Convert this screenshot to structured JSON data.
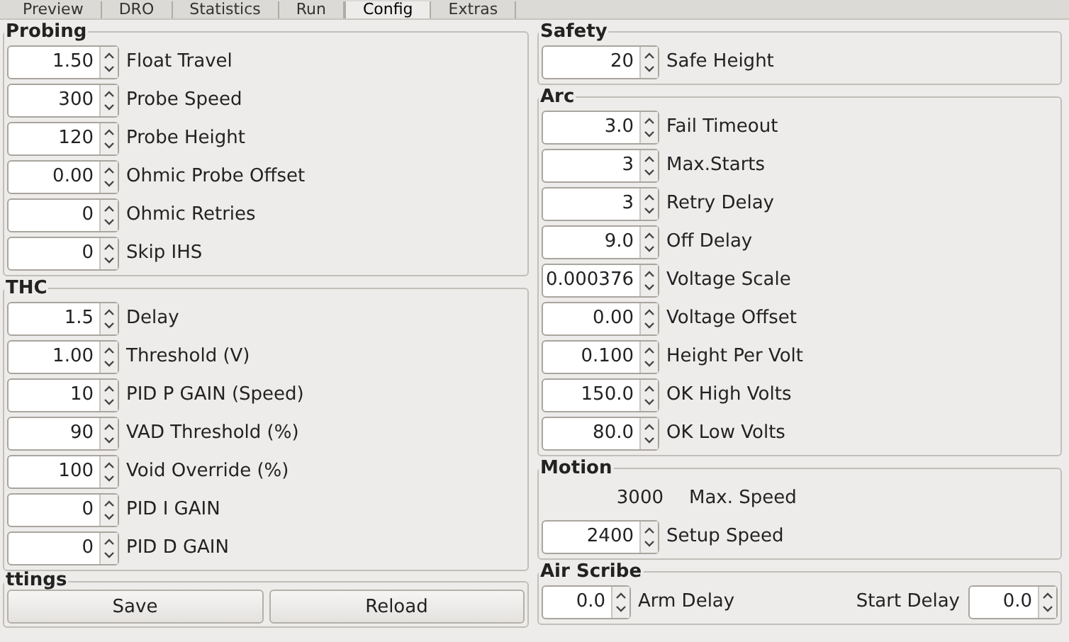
{
  "tabs": [
    {
      "label": "Preview",
      "selected": false
    },
    {
      "label": "DRO",
      "selected": false
    },
    {
      "label": "Statistics",
      "selected": false
    },
    {
      "label": "Run",
      "selected": false
    },
    {
      "label": "Config",
      "selected": true
    },
    {
      "label": "Extras",
      "selected": false
    }
  ],
  "left": [
    {
      "title": "Probing",
      "fields": [
        {
          "kind": "spin",
          "value": "1.50",
          "label": "Float Travel"
        },
        {
          "kind": "spin",
          "value": "300",
          "label": "Probe Speed"
        },
        {
          "kind": "spin",
          "value": "120",
          "label": "Probe Height"
        },
        {
          "kind": "spin",
          "value": "0.00",
          "label": "Ohmic Probe Offset"
        },
        {
          "kind": "spin",
          "value": "0",
          "label": "Ohmic Retries"
        },
        {
          "kind": "spin",
          "value": "0",
          "label": "Skip IHS"
        }
      ]
    },
    {
      "title": "THC",
      "fields": [
        {
          "kind": "spin",
          "value": "1.5",
          "label": "Delay"
        },
        {
          "kind": "spin",
          "value": "1.00",
          "label": "Threshold (V)"
        },
        {
          "kind": "spin",
          "value": "10",
          "label": "PID P GAIN (Speed)"
        },
        {
          "kind": "spin",
          "value": "90",
          "label": "VAD Threshold (%)"
        },
        {
          "kind": "spin",
          "value": "100",
          "label": "Void Override (%)"
        },
        {
          "kind": "spin",
          "value": "0",
          "label": "PID I GAIN"
        },
        {
          "kind": "spin",
          "value": "0",
          "label": "PID D GAIN"
        }
      ]
    }
  ],
  "settings": {
    "title": "ttings",
    "buttons": [
      "Save",
      "Reload"
    ]
  },
  "right": [
    {
      "title": "Safety",
      "fields": [
        {
          "kind": "spin",
          "value": "20",
          "label": "Safe Height"
        }
      ]
    },
    {
      "title": "Arc",
      "fields": [
        {
          "kind": "spin",
          "value": "3.0",
          "label": "Fail Timeout"
        },
        {
          "kind": "spin",
          "value": "3",
          "label": "Max.Starts"
        },
        {
          "kind": "spin",
          "value": "3",
          "label": "Retry Delay"
        },
        {
          "kind": "spin",
          "value": "9.0",
          "label": "Off Delay"
        },
        {
          "kind": "spin",
          "value": "0.000376",
          "label": "Voltage Scale"
        },
        {
          "kind": "spin",
          "value": "0.00",
          "label": "Voltage Offset"
        },
        {
          "kind": "spin",
          "value": "0.100",
          "label": "Height Per Volt"
        },
        {
          "kind": "spin",
          "value": "150.0",
          "label": "OK High Volts"
        },
        {
          "kind": "spin",
          "value": "80.0",
          "label": "OK Low Volts"
        }
      ]
    },
    {
      "title": "Motion",
      "fields": [
        {
          "kind": "readout",
          "value": "3000",
          "label": "Max. Speed"
        },
        {
          "kind": "spin",
          "value": "2400",
          "label": "Setup Speed"
        }
      ]
    },
    {
      "title": "Air Scribe",
      "fields": [
        {
          "kind": "spin",
          "value": "0.0",
          "label": "Arm Delay"
        },
        {
          "kind": "spin-label-first",
          "value": "0.0",
          "label": "Start Delay"
        }
      ]
    }
  ]
}
